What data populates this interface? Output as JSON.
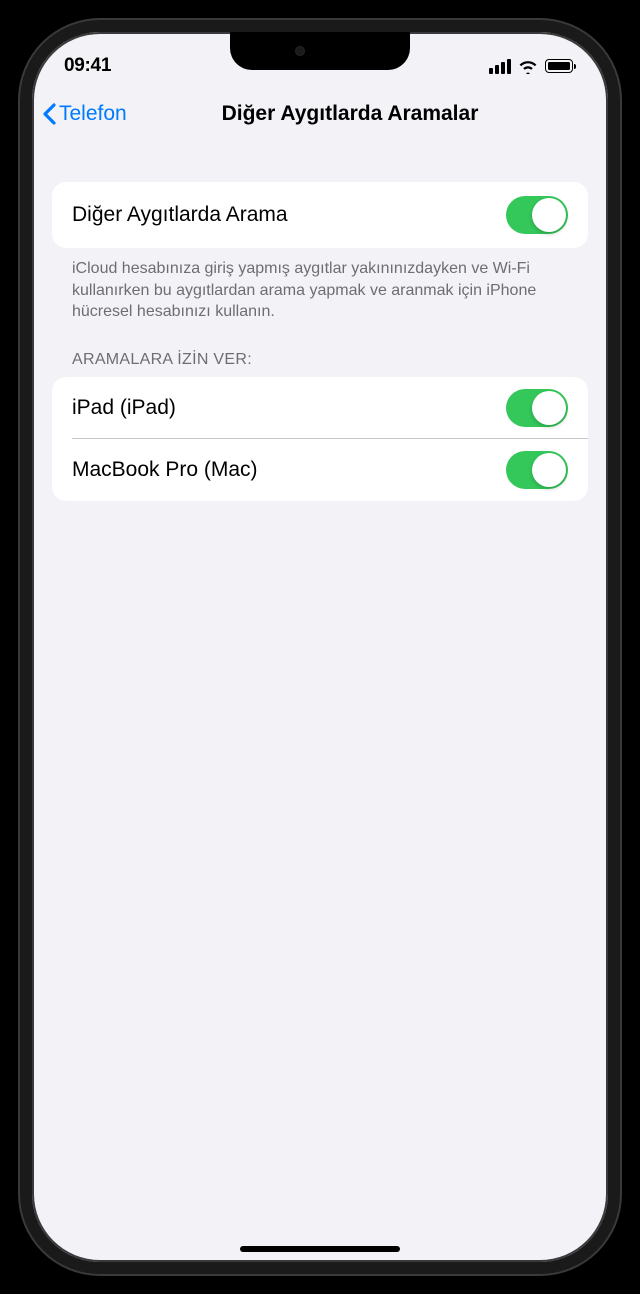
{
  "statusBar": {
    "time": "09:41"
  },
  "nav": {
    "backLabel": "Telefon",
    "title": "Diğer Aygıtlarda Aramalar"
  },
  "mainToggle": {
    "label": "Diğer Aygıtlarda Arama",
    "enabled": true
  },
  "footer": "iCloud hesabınıza giriş yapmış aygıtlar yakınınızdayken ve Wi-Fi kullanırken bu aygıtlardan arama yapmak ve aranmak için iPhone hücresel hesabınızı kullanın.",
  "devicesSection": {
    "header": "ARAMALARA İZİN VER:",
    "devices": [
      {
        "label": "iPad (iPad)",
        "enabled": true
      },
      {
        "label": "MacBook Pro (Mac)",
        "enabled": true
      }
    ]
  }
}
